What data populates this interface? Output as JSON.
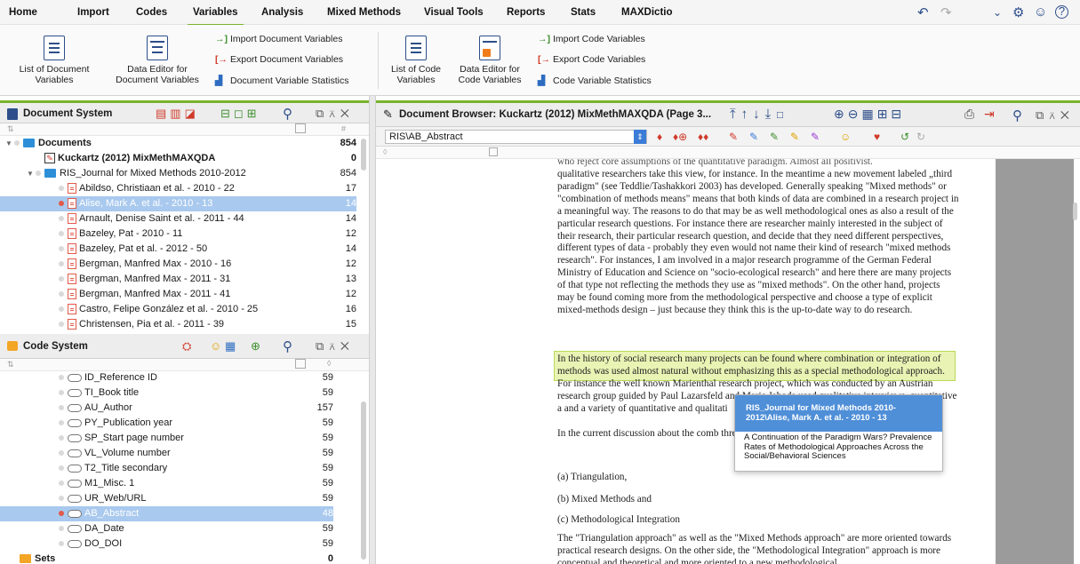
{
  "menu": {
    "items": [
      "Home",
      "Import",
      "Codes",
      "Variables",
      "Analysis",
      "Mixed Methods",
      "Visual Tools",
      "Reports",
      "Stats",
      "MAXDictio"
    ],
    "active": "Variables"
  },
  "ribbon": {
    "list_doc_vars": "List of Document Variables",
    "data_editor_doc": "Data Editor for Document Variables",
    "import_doc_vars": "Import Document Variables",
    "export_doc_vars": "Export Document Variables",
    "doc_var_stats": "Document Variable Statistics",
    "list_code_vars": "List of Code Variables",
    "data_editor_code": "Data Editor for Code Variables",
    "import_code_vars": "Import Code Variables",
    "export_code_vars": "Export Code Variables",
    "code_var_stats": "Code Variable Statistics"
  },
  "document_system": {
    "title": "Document System",
    "count_header": "#",
    "rows": [
      {
        "label": "Documents",
        "count": "854"
      },
      {
        "label": "Kuckartz (2012) MixMethMAXQDA",
        "count": "0"
      },
      {
        "label": "RIS_Journal for Mixed Methods 2010-2012",
        "count": "854"
      },
      {
        "label": "Abildso, Christiaan et al. - 2010 - 22",
        "count": "17"
      },
      {
        "label": "Alise, Mark A. et al. - 2010 - 13",
        "count": "14"
      },
      {
        "label": "Arnault, Denise Saint et al. - 2011 - 44",
        "count": "14"
      },
      {
        "label": "Bazeley, Pat - 2010 - 11",
        "count": "12"
      },
      {
        "label": "Bazeley, Pat et al. - 2012 - 50",
        "count": "14"
      },
      {
        "label": "Bergman, Manfred Max - 2010 - 16",
        "count": "12"
      },
      {
        "label": "Bergman, Manfred Max - 2011 - 31",
        "count": "13"
      },
      {
        "label": "Bergman, Manfred Max - 2011 - 41",
        "count": "12"
      },
      {
        "label": "Castro, Felipe González et al. - 2010 - 25",
        "count": "16"
      },
      {
        "label": "Christensen, Pia et al. - 2011 - 39",
        "count": "15"
      }
    ]
  },
  "code_system": {
    "title": "Code System",
    "rows": [
      {
        "label": "ID_Reference ID",
        "count": "59"
      },
      {
        "label": "TI_Book title",
        "count": "59"
      },
      {
        "label": "AU_Author",
        "count": "157"
      },
      {
        "label": "PY_Publication year",
        "count": "59"
      },
      {
        "label": "SP_Start page number",
        "count": "59"
      },
      {
        "label": "VL_Volume number",
        "count": "59"
      },
      {
        "label": "T2_Title secondary",
        "count": "59"
      },
      {
        "label": "M1_Misc. 1",
        "count": "59"
      },
      {
        "label": "UR_Web/URL",
        "count": "59"
      },
      {
        "label": "AB_Abstract",
        "count": "48"
      },
      {
        "label": "DA_Date",
        "count": "59"
      },
      {
        "label": "DO_DOI",
        "count": "59"
      },
      {
        "label": "Sets",
        "count": "0"
      }
    ]
  },
  "document_browser": {
    "title": "Document Browser: Kuckartz (2012) MixMethMAXQDA  (Page 3...",
    "code_selected": "RIS\\AB_Abstract",
    "paragraphs": [
      "qualitative researchers take this view, for instance. In the meantime a new movement labeled „third paradigm\" (see Teddlie/Tashakkori 2003) has developed. Generally speaking \"Mixed methods\" or \"combination of methods means\" means that both kinds of data are combined in a research project in a meaningful way. The reasons to do that may be as well methodological ones as also a result of the particular research questions. For instance there are researcher mainly interested in the subject of their research, their particular research question, and decide that they need different perspectives, different types of data - probably they even would not name their kind of research \"mixed methods research\". For instances, I am involved in a major research programme of the German Federal Ministry of Education and Science on \"socio-ecological research\" and here there are many projects of that type not reflecting the methods they use as \"mixed methods\". On the other hand, projects may be found coming more from the methodological perspective and choose a type of explicit mixed-methods design – just because they think this is the up-to-date way to do research.",
      "In the history of social research many projects can be found where combination or integration of methods was used almost natural without emphasizing this as a special methodological approach. For instance the well known Marienthal research project, which was conducted by an Austrian research group guided by Paul Lazarsfeld and Marie Jahoda used qualitative interviews, quantitative a and a variety of quantitative and qualitati",
      "In the current discussion about the comb three different approaches (or should we identified:",
      "(a) Triangulation,",
      "(b) Mixed Methods and",
      "(c) Methodological Integration",
      "The \"Triangulation approach\" as well as the \"Mixed Methods approach\" are more oriented towards practical research designs. On the other side, the \"Methodological Integration\" approach is more conceptual and theoretical and more oriented to a new methodological"
    ]
  },
  "popup": {
    "header": "RIS_Journal for Mixed Methods 2010-2012\\Alise, Mark A. et al. - 2010 - 13",
    "body": "A Continuation of the Paradigm Wars? Prevalence Rates of Methodological Approaches Across the Social/Behavioral Sciences"
  },
  "colors": {
    "accent_green": "#79b42d",
    "selection_blue": "#a9c9ee",
    "highlight_yellow": "#e9f3b4",
    "popup_blue": "#4f8fd8"
  }
}
